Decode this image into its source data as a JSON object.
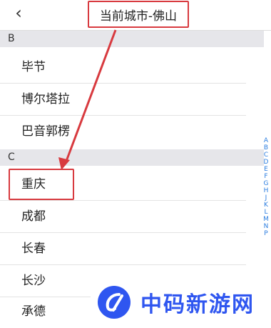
{
  "header": {
    "back_icon": "chevron-left-icon",
    "back_glyph": "‹",
    "title": "当前城市-佛山"
  },
  "sections": [
    {
      "letter": "B",
      "cities": [
        "毕节",
        "博尔塔拉",
        "巴音郭楞"
      ]
    },
    {
      "letter": "C",
      "cities": [
        "重庆",
        "成都",
        "长春",
        "长沙",
        "承德"
      ]
    }
  ],
  "index_letters": [
    "A",
    "B",
    "C",
    "D",
    "E",
    "F",
    "G",
    "H",
    "J",
    "K",
    "L",
    "M",
    "N",
    "P"
  ],
  "annotation_color": "#d83a3f",
  "watermark": {
    "text": "中码新游网",
    "color": "#2f56f0"
  }
}
